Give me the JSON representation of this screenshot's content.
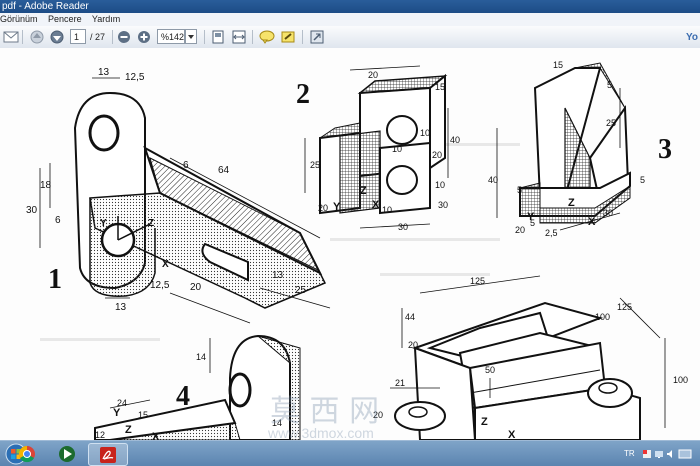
{
  "window": {
    "title": "pdf - Adobe Reader"
  },
  "menu": [
    "Görünüm",
    "Pencere",
    "Yardım"
  ],
  "toolbar": {
    "page_current": "1",
    "page_total": "/ 27",
    "zoom": "%142",
    "right_label": "Yo"
  },
  "drawings": {
    "fig1": {
      "number": "1",
      "dims": [
        "13",
        "12,5",
        "18",
        "30",
        "6",
        "64",
        "6",
        "12,5",
        "13",
        "20",
        "13",
        "25",
        "X",
        "Y",
        "Z"
      ]
    },
    "fig2": {
      "number": "2",
      "dims": [
        "20",
        "15",
        "25",
        "10",
        "20",
        "40",
        "20",
        "10",
        "30",
        "10",
        "10",
        "30",
        "X",
        "Y",
        "Z"
      ]
    },
    "fig3": {
      "number": "3",
      "dims": [
        "15",
        "5",
        "25",
        "5",
        "40",
        "5",
        "20",
        "5",
        "2,5",
        "30",
        "X",
        "Y",
        "Z"
      ]
    },
    "fig4": {
      "number": "4",
      "dims": [
        "14",
        "24",
        "15",
        "12",
        "14",
        "X",
        "Y",
        "Z"
      ]
    },
    "fig5": {
      "dims": [
        "125",
        "44",
        "20",
        "125",
        "100",
        "50",
        "100",
        "21",
        "20",
        "X",
        "Z"
      ]
    },
    "watermark": "莫 西 网",
    "watermark_url": "www.3dmox.com"
  },
  "taskbar": {
    "lang": "TR"
  },
  "colors": {
    "titlebar": "#1d4c86",
    "taskbar": "#5b84b0",
    "pdf_red": "#c8231c"
  }
}
